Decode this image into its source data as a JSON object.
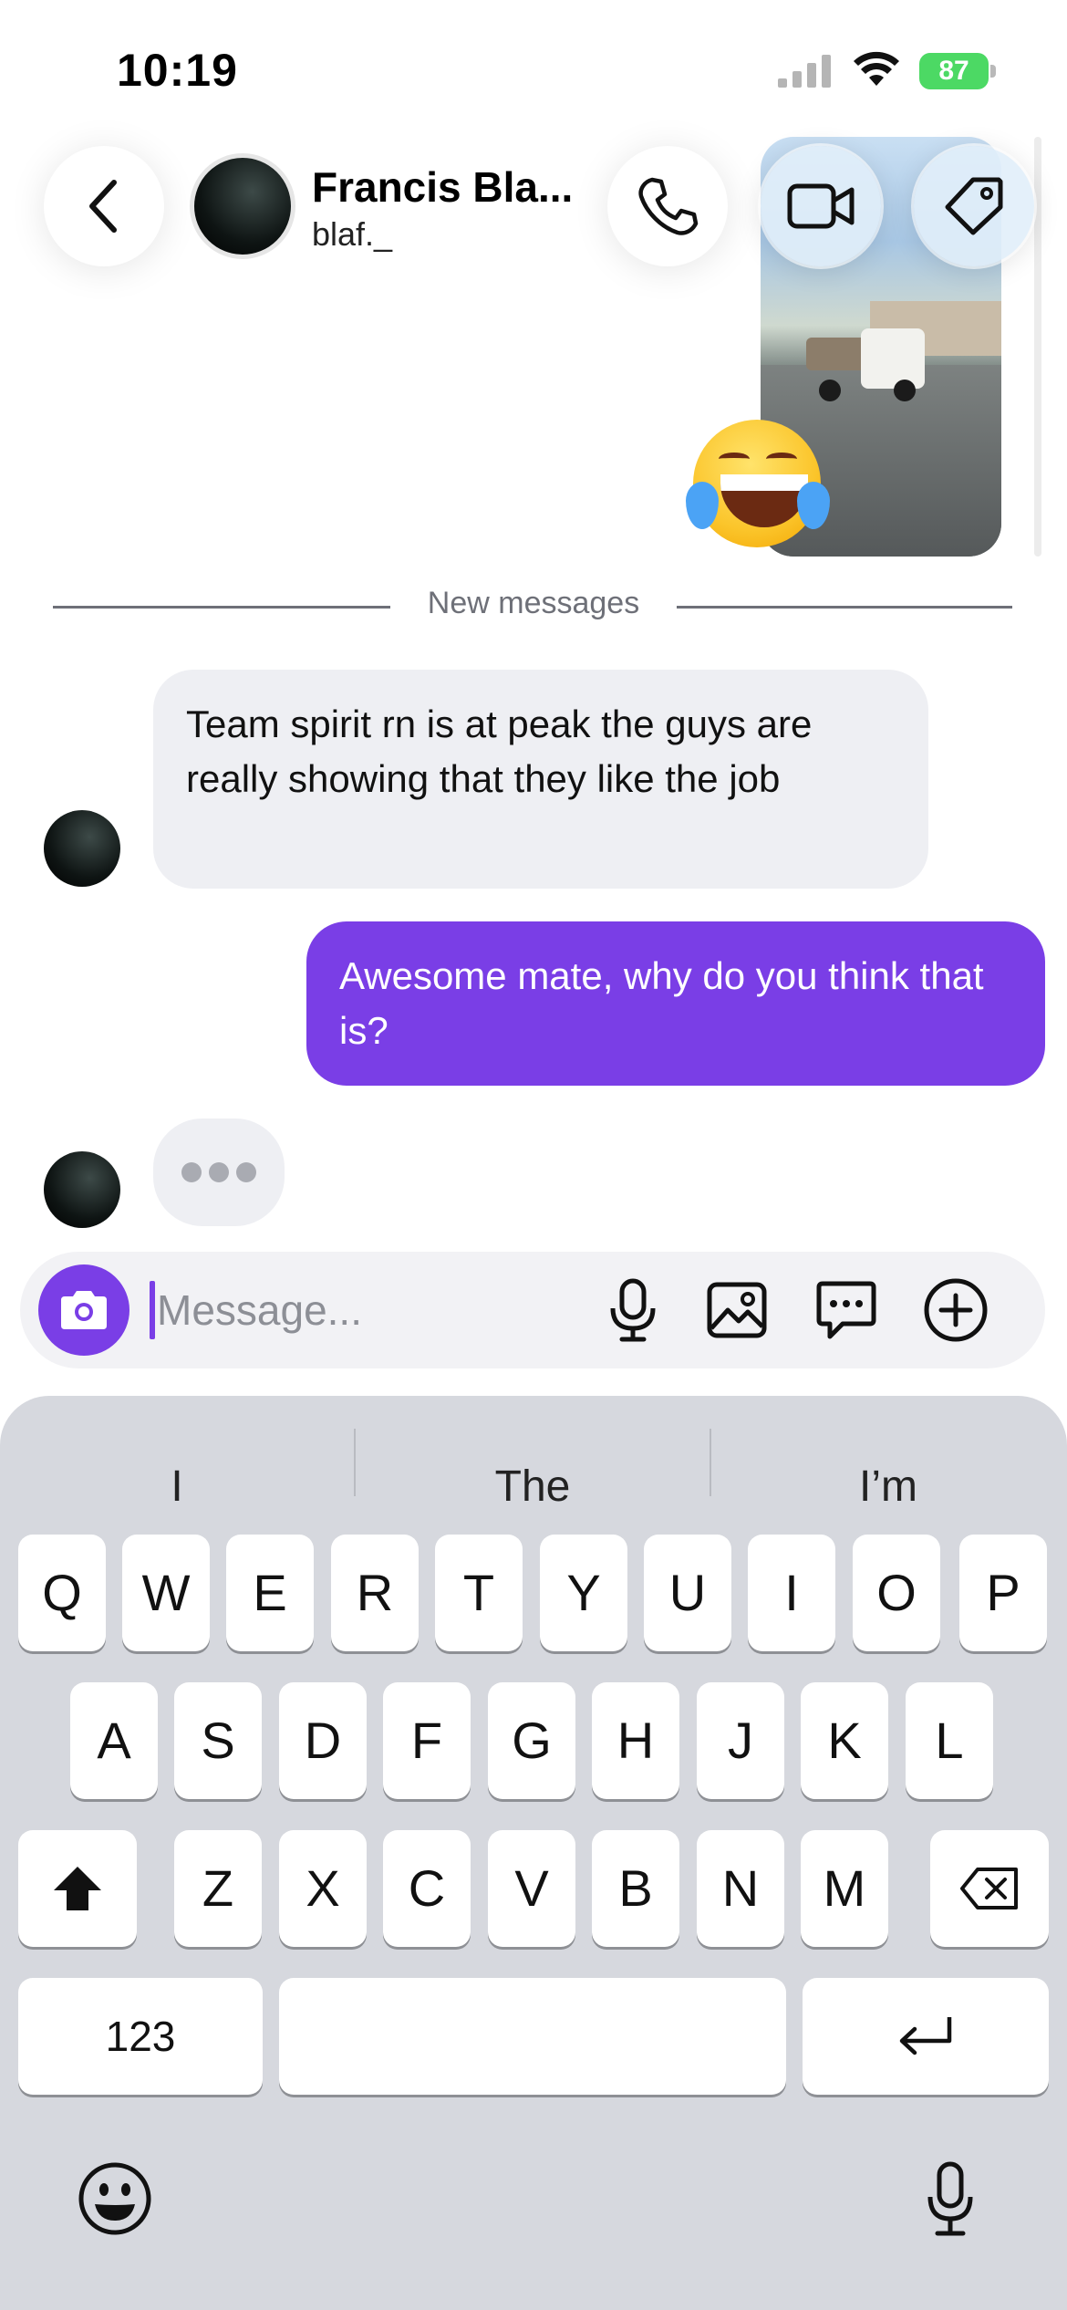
{
  "status_bar": {
    "time": "10:19",
    "battery": "87"
  },
  "header": {
    "contact_name": "Francis Bla...",
    "contact_handle": "blaf._"
  },
  "divider": {
    "label": "New messages"
  },
  "messages": {
    "incoming_1": "Team spirit rn is at peak the guys are really showing that they like the job",
    "outgoing_1": "Awesome mate, why do you think that is?"
  },
  "composer": {
    "placeholder": "Message..."
  },
  "keyboard": {
    "suggestions": [
      "I",
      "The",
      "I’m"
    ],
    "row1": [
      "Q",
      "W",
      "E",
      "R",
      "T",
      "Y",
      "U",
      "I",
      "O",
      "P"
    ],
    "row2": [
      "A",
      "S",
      "D",
      "F",
      "G",
      "H",
      "J",
      "K",
      "L"
    ],
    "row3": [
      "Z",
      "X",
      "C",
      "V",
      "B",
      "N",
      "M"
    ],
    "numbers_label": "123"
  },
  "colors": {
    "accent": "#7a3ee6",
    "incoming_bubble": "#eeeff3",
    "keyboard_bg": "#d6d8de"
  }
}
